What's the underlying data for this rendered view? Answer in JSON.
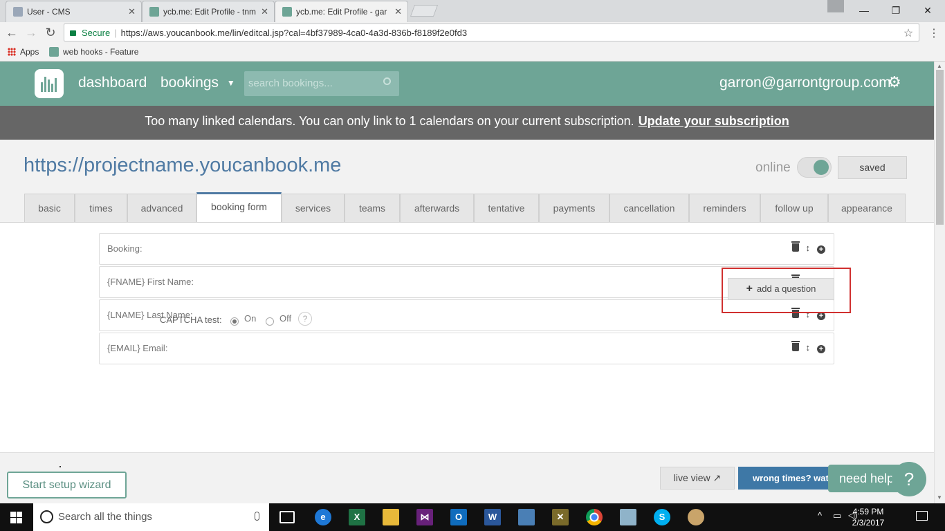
{
  "browser": {
    "tabs": [
      {
        "title": "User - CMS",
        "active": false
      },
      {
        "title": "ycb.me: Edit Profile - tnm",
        "active": false
      },
      {
        "title": "ycb.me: Edit Profile - gar",
        "active": true
      }
    ],
    "secure_label": "Secure",
    "url": "https://aws.youcanbook.me/lin/editcal.jsp?cal=4bf37989-4ca0-4a3d-836b-f8189f2e0fd3",
    "bookmarks": {
      "apps": "Apps",
      "webhooks": "web hooks - Feature"
    }
  },
  "nav": {
    "dashboard": "dashboard",
    "bookings": "bookings",
    "search_placeholder": "search bookings...",
    "account": "garron@garrontgroup.com"
  },
  "banner": {
    "message": "Too many linked calendars. You can only link to 1 calendars on your current subscription.",
    "link": "Update your subscription"
  },
  "profile": {
    "site_url": "https://projectname.youcanbook.me",
    "online_label": "online",
    "online": true,
    "saved_label": "saved"
  },
  "tabs": [
    "basic",
    "times",
    "advanced",
    "booking form",
    "services",
    "teams",
    "afterwards",
    "tentative",
    "payments",
    "cancellation",
    "reminders",
    "follow up",
    "appearance"
  ],
  "active_tab": "booking form",
  "questions": [
    "Booking:",
    "{FNAME} First Name:",
    "{LNAME} Last Name:",
    "{EMAIL} Email:"
  ],
  "add_question": "add a question",
  "captcha": {
    "label": "CAPTCHA test:",
    "on": "On",
    "off": "Off",
    "help": "?",
    "selected": "On"
  },
  "footer": {
    "wizard": "Start setup wizard",
    "live_view": "live view",
    "wrong_times": "wrong times? wat",
    "need_help": "need help",
    "help_q": "?"
  },
  "taskbar": {
    "search": "Search all the things",
    "time": "4:59 PM",
    "date": "2/3/2017"
  },
  "colors": {
    "brand": "#6ea596",
    "banner": "#666666",
    "link": "#4f7aa3",
    "primary_button": "#3e78a6",
    "highlight": "#d0302f"
  }
}
